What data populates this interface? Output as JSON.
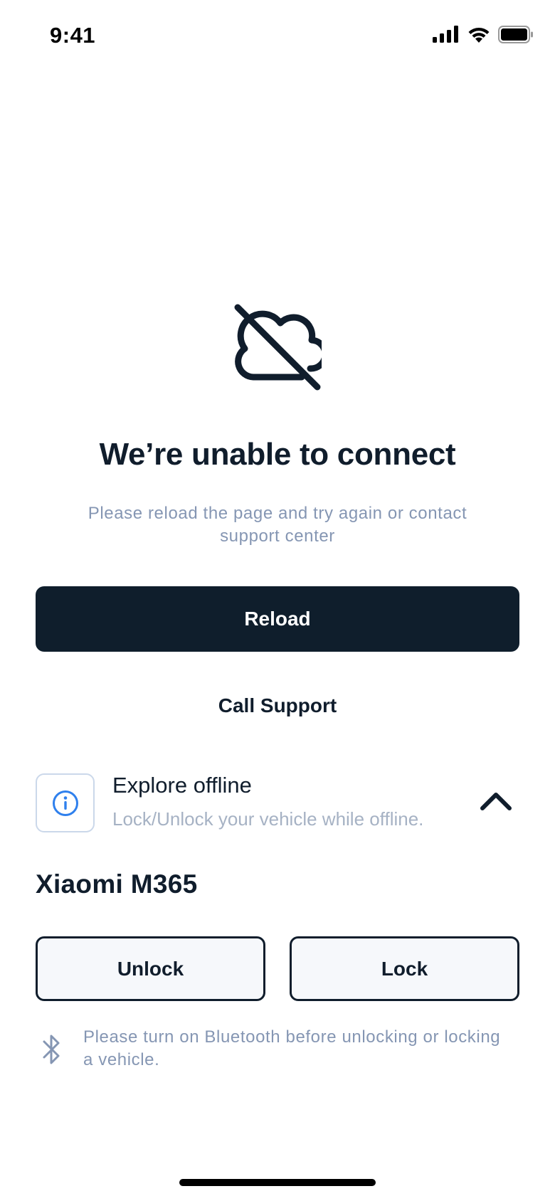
{
  "status_bar": {
    "time": "9:41",
    "icons": [
      "cellular-signal-icon",
      "wifi-icon",
      "battery-icon"
    ]
  },
  "error": {
    "icon": "cloud-off-icon",
    "title": "We’re unable to connect",
    "subtitle": "Please reload the page and try again or contact support center"
  },
  "actions": {
    "reload_label": "Reload",
    "call_support_label": "Call Support"
  },
  "offline": {
    "icon": "info-icon",
    "title": "Explore offline",
    "subtitle": "Lock/Unlock your vehicle while offline.",
    "expanded_icon": "chevron-up-icon"
  },
  "vehicle": {
    "name": "Xiaomi M365",
    "unlock_label": "Unlock",
    "lock_label": "Lock"
  },
  "bluetooth_note": {
    "icon": "bluetooth-icon",
    "text": "Please turn on Bluetooth before unlocking or locking a vehicle."
  },
  "colors": {
    "primary": "#0f1e2c",
    "muted_text": "#8596b3",
    "info_blue": "#2f80ed",
    "button_bg": "#f6f8fb"
  }
}
